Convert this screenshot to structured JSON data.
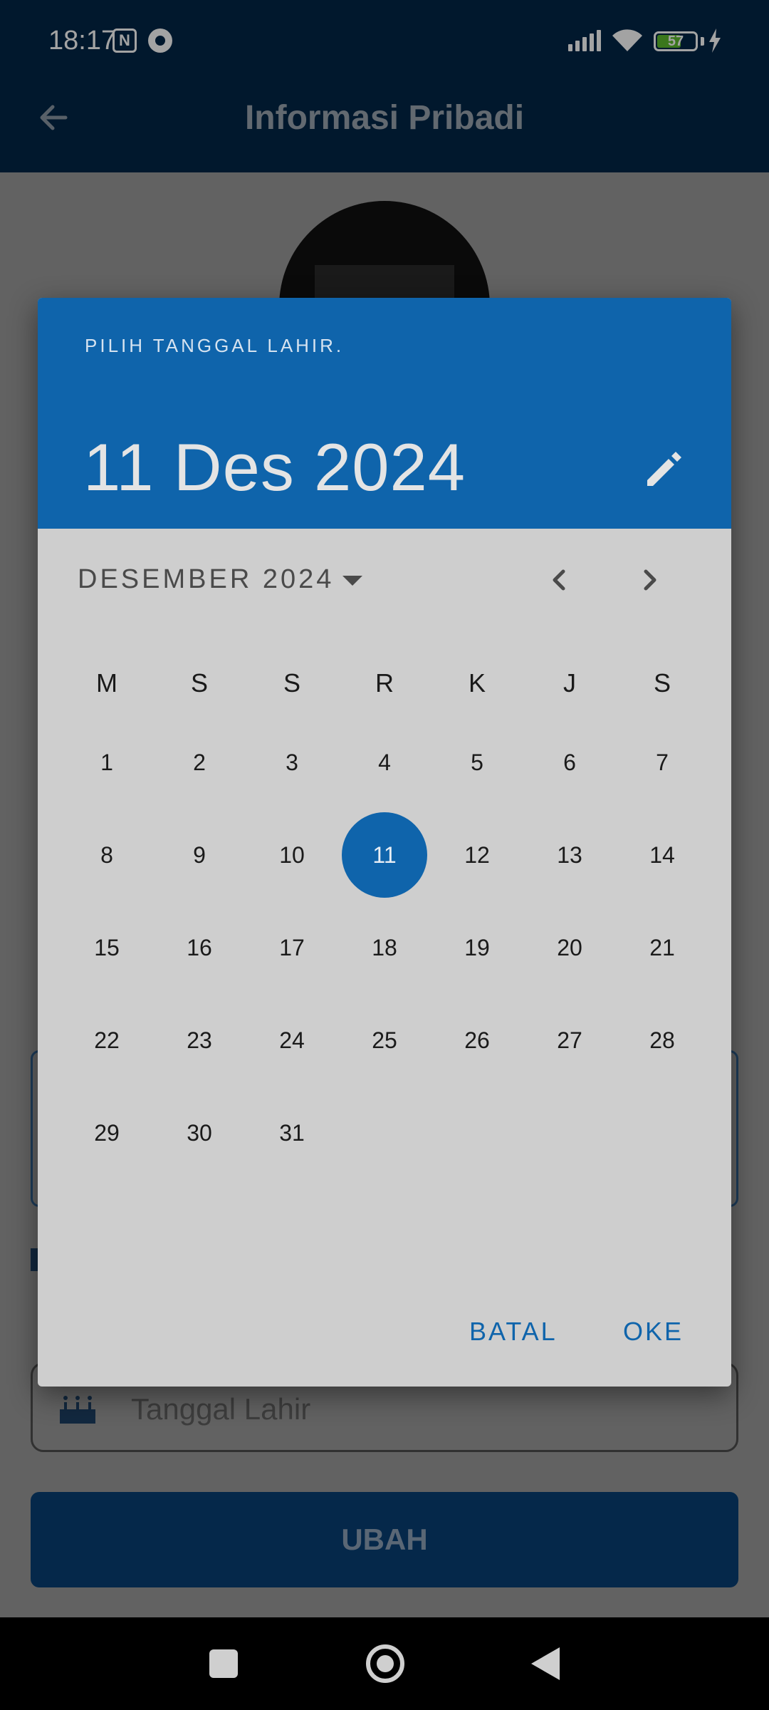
{
  "status_bar": {
    "time": "18:17",
    "nfc_glyph": "N",
    "battery_level": "57"
  },
  "app_bar": {
    "title": "Informasi Pribadi"
  },
  "form": {
    "birth_date_placeholder": "Tanggal Lahir",
    "submit_label": "UBAH"
  },
  "date_picker": {
    "help_text": "PILIH TANGGAL LAHIR.",
    "selected_date": "11 Des 2024",
    "month_year": "DESEMBER 2024",
    "weekdays": [
      "M",
      "S",
      "S",
      "R",
      "K",
      "J",
      "S"
    ],
    "days": [
      "1",
      "2",
      "3",
      "4",
      "5",
      "6",
      "7",
      "8",
      "9",
      "10",
      "11",
      "12",
      "13",
      "14",
      "15",
      "16",
      "17",
      "18",
      "19",
      "20",
      "21",
      "22",
      "23",
      "24",
      "25",
      "26",
      "27",
      "28",
      "29",
      "30",
      "31"
    ],
    "selected_day": "11",
    "cancel_label": "BATAL",
    "ok_label": "OKE"
  },
  "colors": {
    "app_bar": "#032747",
    "accent": "#0f64ab",
    "dialog_surface": "#cecece"
  },
  "icons": [
    "back-arrow-icon",
    "edit-pencil-icon",
    "dropdown-arrow-icon",
    "chevron-left-icon",
    "chevron-right-icon",
    "birthday-cake-icon",
    "wifi-icon",
    "signal-icon",
    "battery-icon"
  ]
}
